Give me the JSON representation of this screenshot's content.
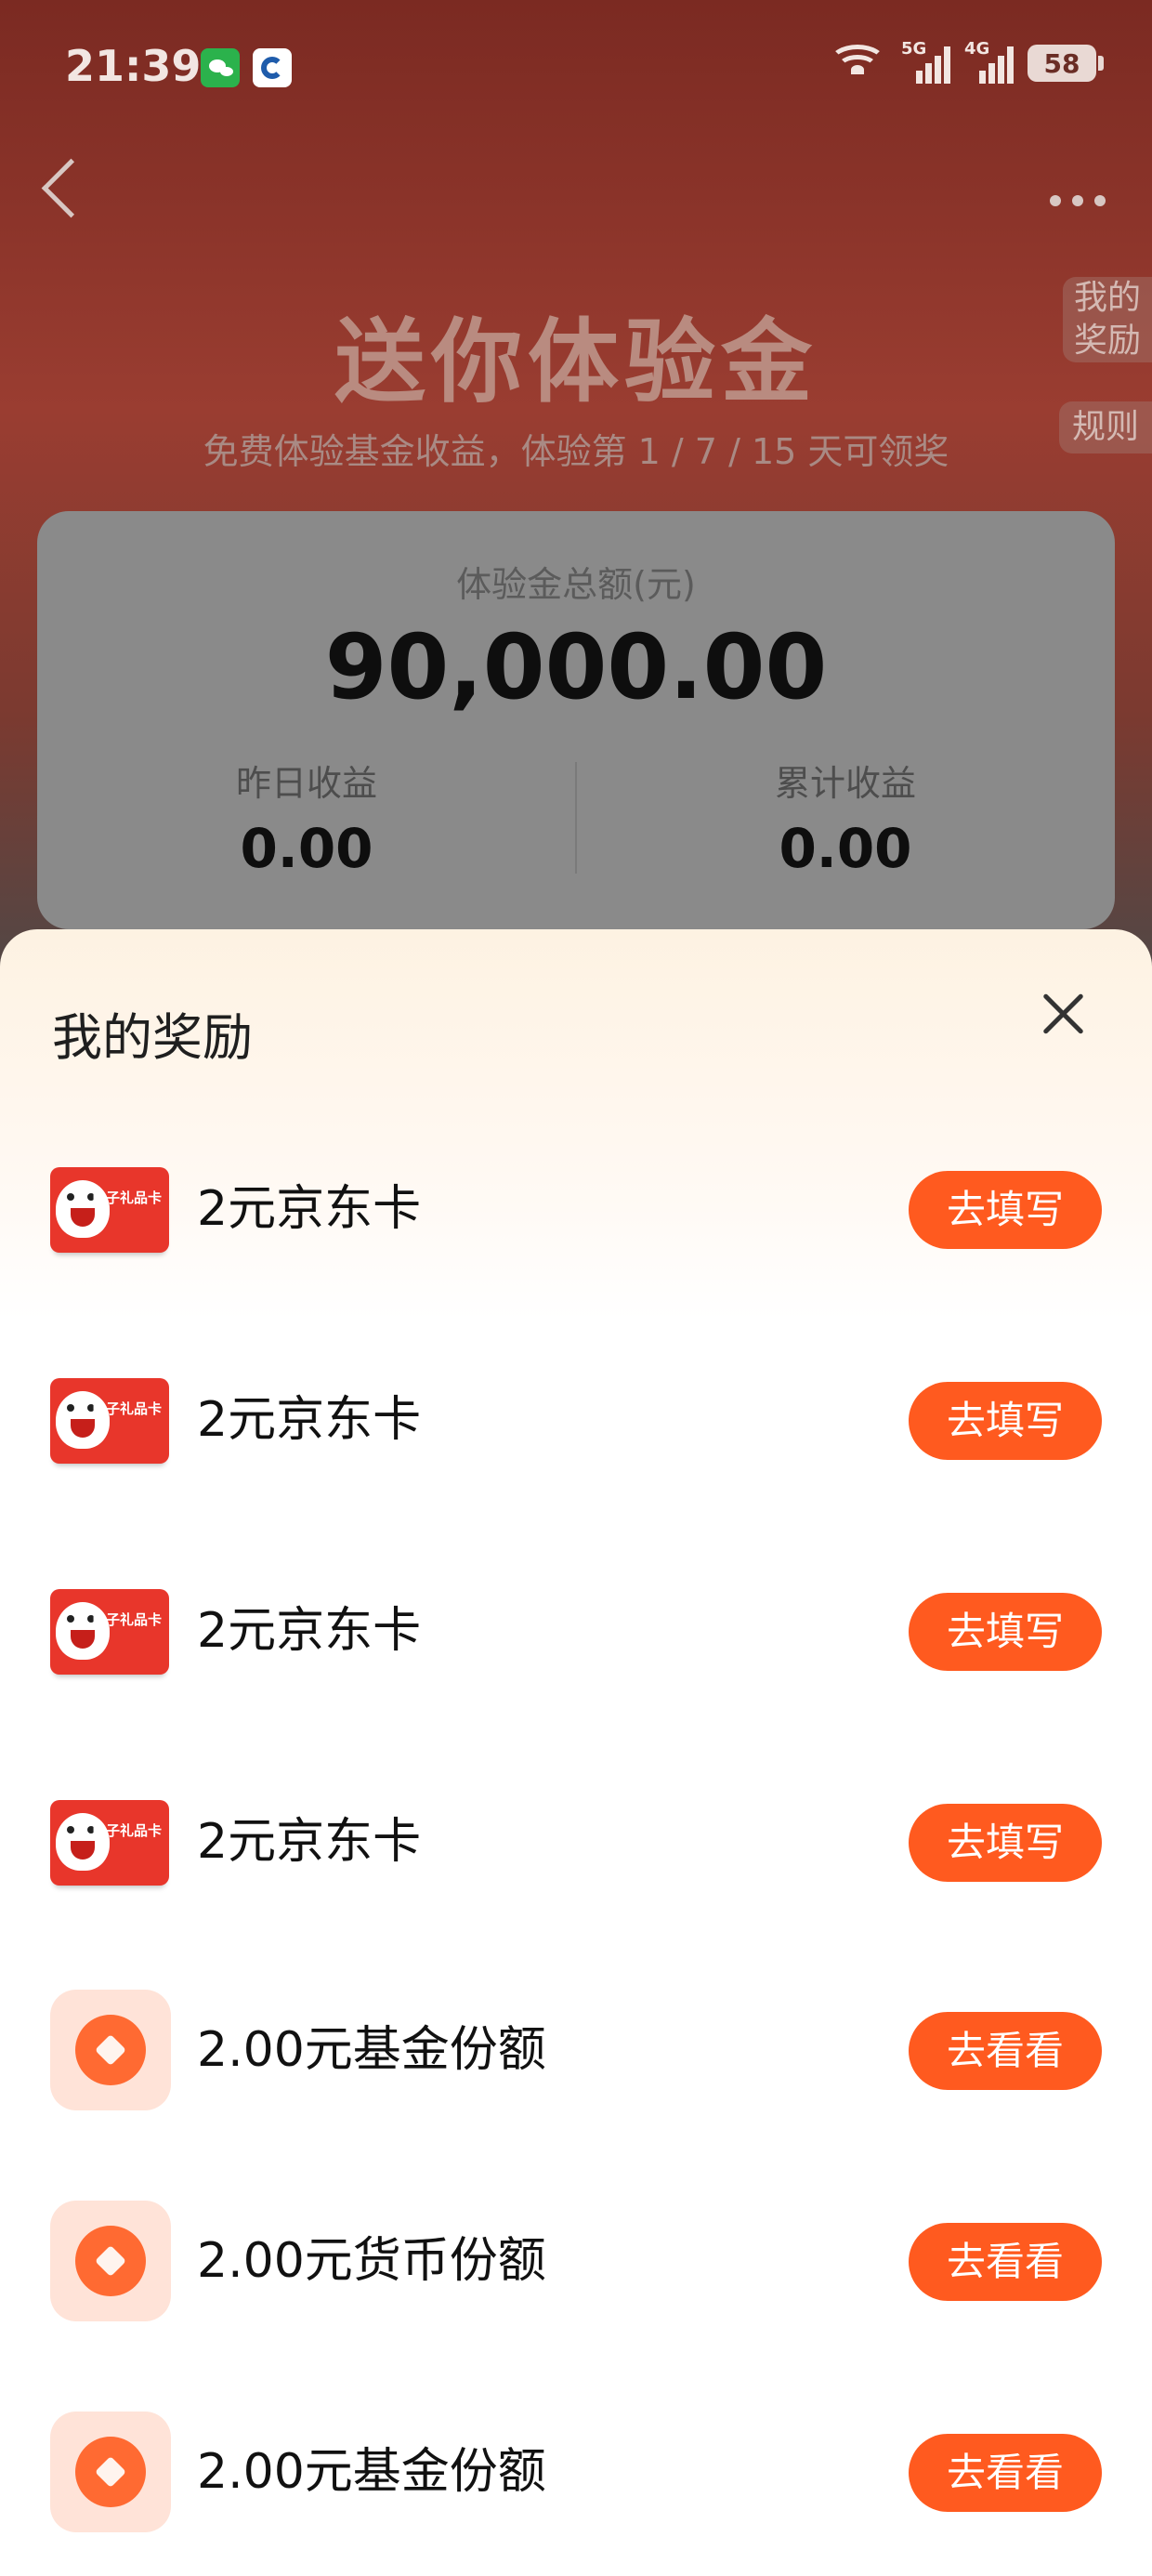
{
  "status_bar": {
    "time": "21:39",
    "battery": "58",
    "sig1_label": "5G",
    "sig2_label": "4G"
  },
  "background": {
    "title": "送你体验金",
    "subtitle": "免费体验基金收益，体验第 1 / 7 / 15 天可领奖",
    "side_tab_rewards": "我的奖励",
    "side_tab_rules": "规则",
    "card": {
      "total_label": "体验金总额(元)",
      "total_value": "90,000.00",
      "yesterday_label": "昨日收益",
      "yesterday_value": "0.00",
      "cumulative_label": "累计收益",
      "cumulative_value": "0.00"
    }
  },
  "sheet": {
    "title": "我的奖励",
    "rewards": [
      {
        "type": "jd-card",
        "label": "2元京东卡",
        "action": "去填写"
      },
      {
        "type": "jd-card",
        "label": "2元京东卡",
        "action": "去填写"
      },
      {
        "type": "jd-card",
        "label": "2元京东卡",
        "action": "去填写"
      },
      {
        "type": "jd-card",
        "label": "2元京东卡",
        "action": "去填写"
      },
      {
        "type": "coin",
        "label": "2.00元基金份额",
        "action": "去看看"
      },
      {
        "type": "coin",
        "label": "2.00元货币份额",
        "action": "去看看"
      },
      {
        "type": "coin",
        "label": "2.00元基金份额",
        "action": "去看看"
      }
    ],
    "jd_card_caption": "电子礼品卡"
  }
}
